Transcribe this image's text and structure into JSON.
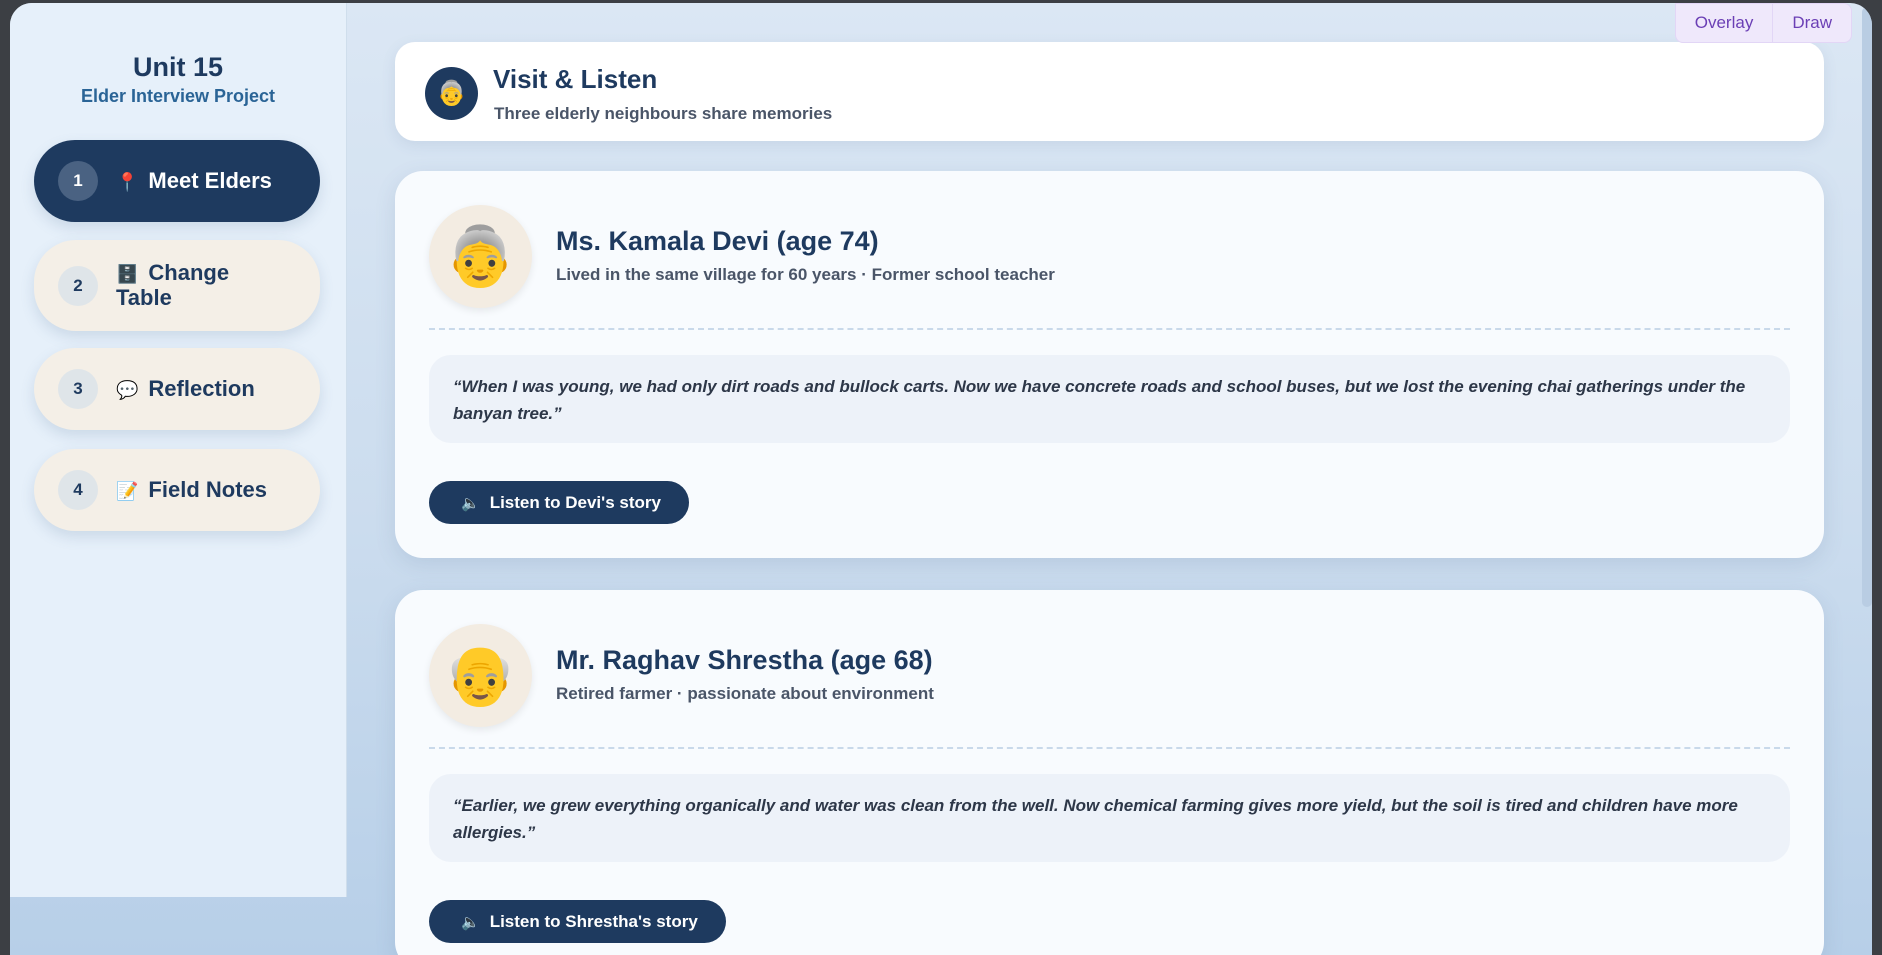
{
  "toolbar": {
    "overlay_label": "Overlay",
    "draw_label": "Draw"
  },
  "sidebar": {
    "title": "Unit 15",
    "subtitle": "Elder Interview Project",
    "items": [
      {
        "num": "1",
        "emoji": "📍",
        "label": "Meet Elders",
        "active": true
      },
      {
        "num": "2",
        "emoji": "🗄️",
        "label": "Change Table",
        "active": false
      },
      {
        "num": "3",
        "emoji": "💬",
        "label": "Reflection",
        "active": false
      },
      {
        "num": "4",
        "emoji": "📝",
        "label": "Field Notes",
        "active": false
      }
    ]
  },
  "header": {
    "icon": "👵",
    "title": "Visit & Listen",
    "subtitle": "Three elderly neighbours share memories"
  },
  "elders": [
    {
      "avatar": "👵",
      "name": "Ms. Kamala Devi (age 74)",
      "desc": "Lived in the same village for 60 years · Former school teacher",
      "quote": "“When I was young, we had only dirt roads and bullock carts. Now we have concrete roads and school buses, but we lost the evening chai gatherings under the banyan tree.”",
      "button_label": "Listen to Devi's story"
    },
    {
      "avatar": "👴",
      "name": "Mr. Raghav Shrestha (age 68)",
      "desc": "Retired farmer · passionate about environment",
      "quote": "“Earlier, we grew everything organically and water was clean from the well. Now chemical farming gives more yield, but the soil is tired and children have more allergies.”",
      "button_label": "Listen to Shrestha's story"
    }
  ],
  "icons": {
    "speaker": "🔈"
  },
  "colors": {
    "primary": "#1e3a5f",
    "accent_purple": "#6b3fb5"
  }
}
